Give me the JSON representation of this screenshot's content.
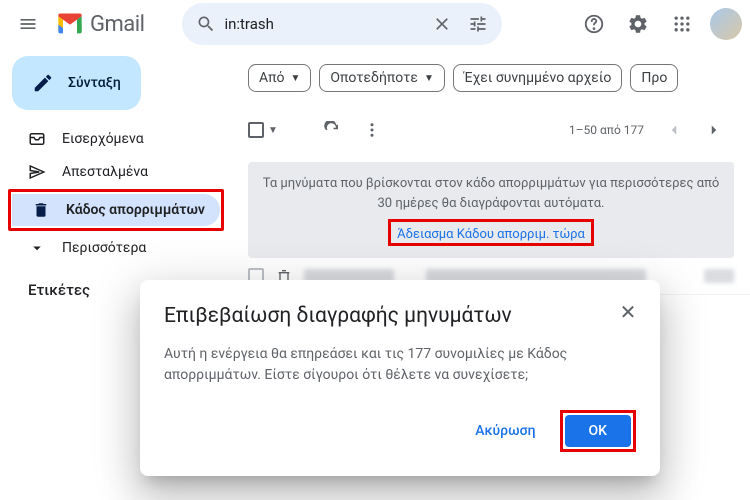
{
  "app": {
    "name": "Gmail"
  },
  "search": {
    "query": "in:trash"
  },
  "compose": {
    "label": "Σύνταξη"
  },
  "sidebar": {
    "items": [
      {
        "label": "Εισερχόμενα"
      },
      {
        "label": "Απεσταλμένα"
      },
      {
        "label": "Κάδος απορριμμάτων"
      },
      {
        "label": "Περισσότερα"
      }
    ],
    "labels_header": "Ετικέτες"
  },
  "filters": {
    "from": "Από",
    "any_time": "Οποτεδήποτε",
    "has_attachment": "Έχει συνημμένο αρχείο",
    "to": "Προ"
  },
  "pagination": {
    "text": "1–50 από 177"
  },
  "notice": {
    "text": "Τα μηνύματα που βρίσκονται στον κάδο απορριμμάτων για περισσότερες από 30 ημέρες θα διαγράφονται αυτόματα.",
    "link": "Άδειασμα Κάδου απορριμ. τώρα"
  },
  "modal": {
    "title": "Επιβεβαίωση διαγραφής μηνυμάτων",
    "body": "Αυτή η ενέργεια θα επηρεάσει και τις 177 συνομιλίες με Κάδος απορριμμάτων. Είστε σίγουροι ότι θέλετε να συνεχίσετε;",
    "cancel": "Ακύρωση",
    "ok": "OK"
  }
}
